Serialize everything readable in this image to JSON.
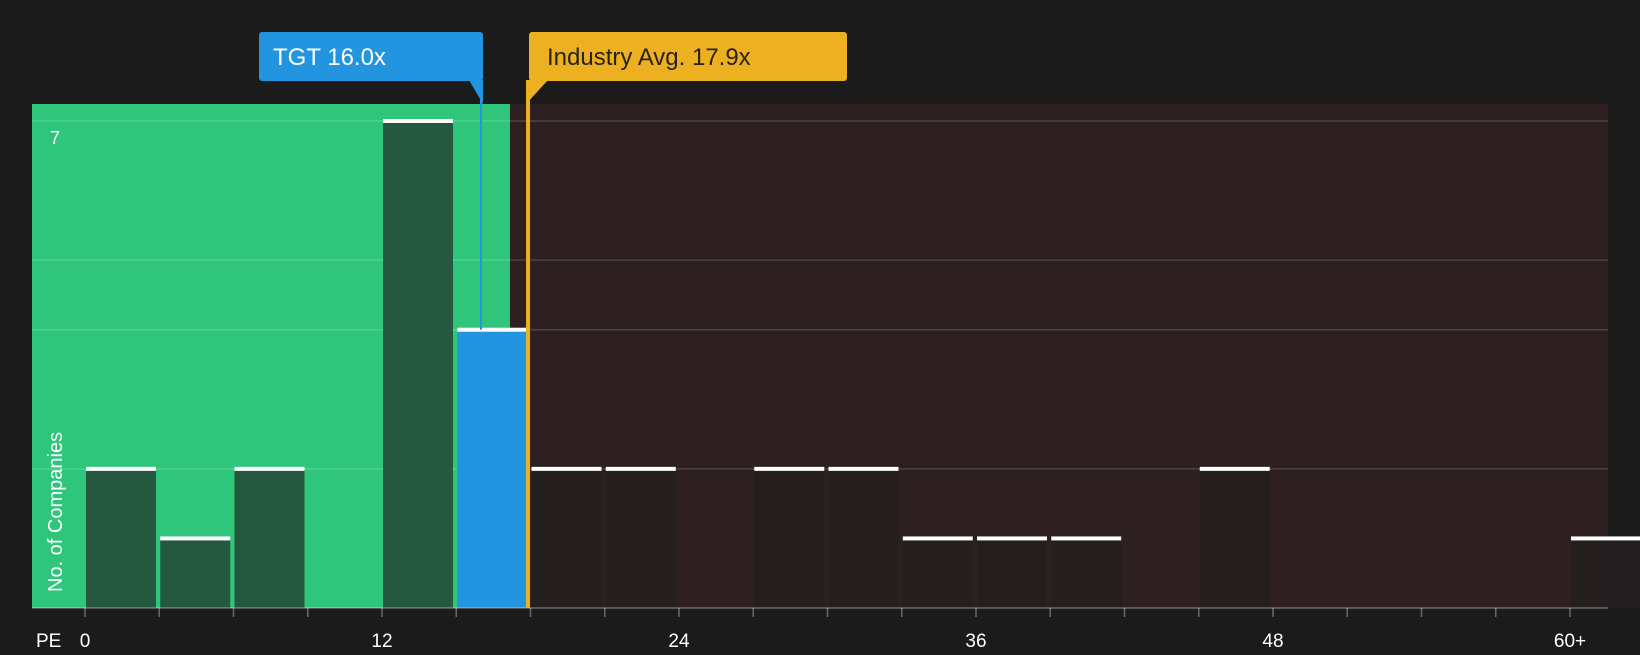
{
  "chart_data": {
    "type": "bar",
    "title": "",
    "xlabel": "PE",
    "ylabel": "No. of Companies",
    "bins": [
      {
        "x": 0,
        "value": 2
      },
      {
        "x": 3,
        "value": 1
      },
      {
        "x": 6,
        "value": 2
      },
      {
        "x": 9,
        "value": 0
      },
      {
        "x": 12,
        "value": 7
      },
      {
        "x": 15,
        "value": 4,
        "highlight": true
      },
      {
        "x": 18,
        "value": 2
      },
      {
        "x": 21,
        "value": 2
      },
      {
        "x": 24,
        "value": 0
      },
      {
        "x": 27,
        "value": 2
      },
      {
        "x": 30,
        "value": 2
      },
      {
        "x": 33,
        "value": 1
      },
      {
        "x": 36,
        "value": 1
      },
      {
        "x": 39,
        "value": 1
      },
      {
        "x": 42,
        "value": 0
      },
      {
        "x": 45,
        "value": 2
      },
      {
        "x": 48,
        "value": 0
      },
      {
        "x": 51,
        "value": 0
      },
      {
        "x": 54,
        "value": 0
      },
      {
        "x": 57,
        "value": 0
      },
      {
        "x": 60,
        "value": 1
      }
    ],
    "x_ticks": [
      0,
      3,
      6,
      9,
      12,
      15,
      18,
      21,
      24,
      27,
      30,
      33,
      36,
      39,
      42,
      45,
      48,
      51,
      54,
      57,
      60
    ],
    "x_tick_labels": [
      {
        "value": 0,
        "label": "0"
      },
      {
        "value": 12,
        "label": "12"
      },
      {
        "value": 24,
        "label": "24"
      },
      {
        "value": 36,
        "label": "36"
      },
      {
        "value": 48,
        "label": "48"
      },
      {
        "value": 60,
        "label": "60+"
      }
    ],
    "y_max_label": "7",
    "ylim": [
      0,
      7
    ],
    "y_gridlines": [
      2,
      4,
      5,
      7
    ],
    "markers": {
      "company": {
        "label": "TGT 16.0x",
        "value": 16.0,
        "color": "#2394e0"
      },
      "industry": {
        "label": "Industry Avg. 17.9x",
        "value": 17.9,
        "color": "#ecb021"
      }
    },
    "colors": {
      "below_zone": "#2fc67b",
      "above_zone": "#2e1f20",
      "bar_in_green": "#23513b",
      "bar_dark": "#241e1f",
      "highlight_bar": "#2394e0",
      "bar_cap": "#ffffff"
    }
  }
}
